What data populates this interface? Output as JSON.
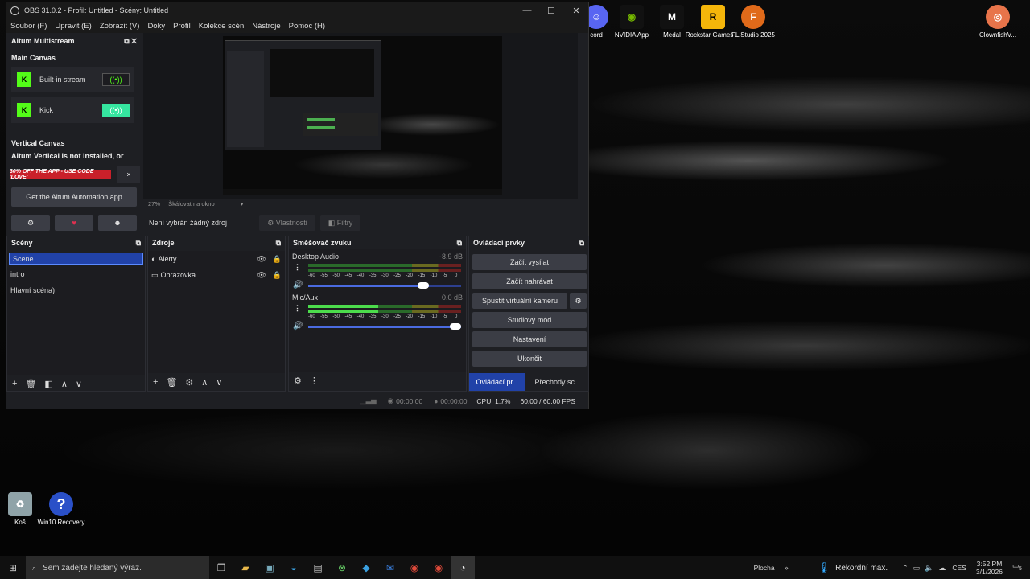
{
  "window": {
    "title": "OBS 31.0.2 - Profil: Untitled - Scény: Untitled"
  },
  "menu": [
    "Soubor (F)",
    "Upravit (E)",
    "Zobrazit (V)",
    "Doky",
    "Profil",
    "Kolekce scén",
    "Nástroje",
    "Pomoc (H)"
  ],
  "aitum": {
    "title": "Aitum Multistream",
    "main_canvas": "Main Canvas",
    "items": [
      "Built-in stream",
      "Kick"
    ],
    "vertical_canvas": "Vertical Canvas",
    "vertical_note": "Aitum Vertical is not installed, or",
    "promo": "30% OFF THE APP - USE CODE 'LOVE'",
    "promo_close": "×",
    "app_button": "Get the Aitum Automation app"
  },
  "preview": {
    "zoom": "27%",
    "scale_label": "Škálovat na okno"
  },
  "source_bar": {
    "no_source": "Není vybrán žádný zdroj",
    "properties": "Vlastnosti",
    "filters": "Filtry"
  },
  "scenes": {
    "title": "Scény",
    "items": [
      "Scene",
      "intro",
      "Hlavní scéna)"
    ]
  },
  "sources": {
    "title": "Zdroje",
    "items": [
      "Alerty",
      "Obrazovka"
    ]
  },
  "mixer": {
    "title": "Směšovač zvuku",
    "channels": [
      {
        "name": "Desktop Audio",
        "db": "-8.9 dB",
        "level": 0.0,
        "volume": 0.79
      },
      {
        "name": "Mic/Aux",
        "db": "0.0 dB",
        "level": 0.46,
        "volume": 1.0
      }
    ],
    "ticks": [
      "-60",
      "-55",
      "-50",
      "-45",
      "-40",
      "-35",
      "-30",
      "-25",
      "-20",
      "-15",
      "-10",
      "-5",
      "0"
    ]
  },
  "controls": {
    "title": "Ovládací prvky",
    "buttons": [
      "Začít vysílat",
      "Začít nahrávat",
      "Spustit virtuální kameru",
      "Studiový mód",
      "Nastavení",
      "Ukončit"
    ],
    "tabs": [
      "Ovládací pr...",
      "Přechody sc..."
    ]
  },
  "status": {
    "stream_time": "00:00:00",
    "rec_time": "00:00:00",
    "cpu": "CPU: 1.7%",
    "fps": "60.00 / 60.00 FPS"
  },
  "desktop_icons": [
    {
      "label": "cord",
      "color": "#5865f2"
    },
    {
      "label": "NVIDIA App",
      "color": "#222"
    },
    {
      "label": "Medal",
      "color": "#111"
    },
    {
      "label": "Rockstar Games ...",
      "color": "#f5b60a"
    },
    {
      "label": "FL Studio 2025",
      "color": "#e06a1a"
    },
    {
      "label": "ClownfishV...",
      "color": "#e8744a"
    },
    {
      "label": "Koš",
      "color": "#9bb"
    },
    {
      "label": "Win10 Recovery",
      "color": "#2a50c8"
    }
  ],
  "taskbar": {
    "search_placeholder": "Sem zadejte hledaný výraz.",
    "desktop": "Plocha",
    "weather": "Rekordní max.",
    "lang": "CES",
    "time": "3:52 PM",
    "date": "3/1/2026",
    "notif": "5"
  }
}
